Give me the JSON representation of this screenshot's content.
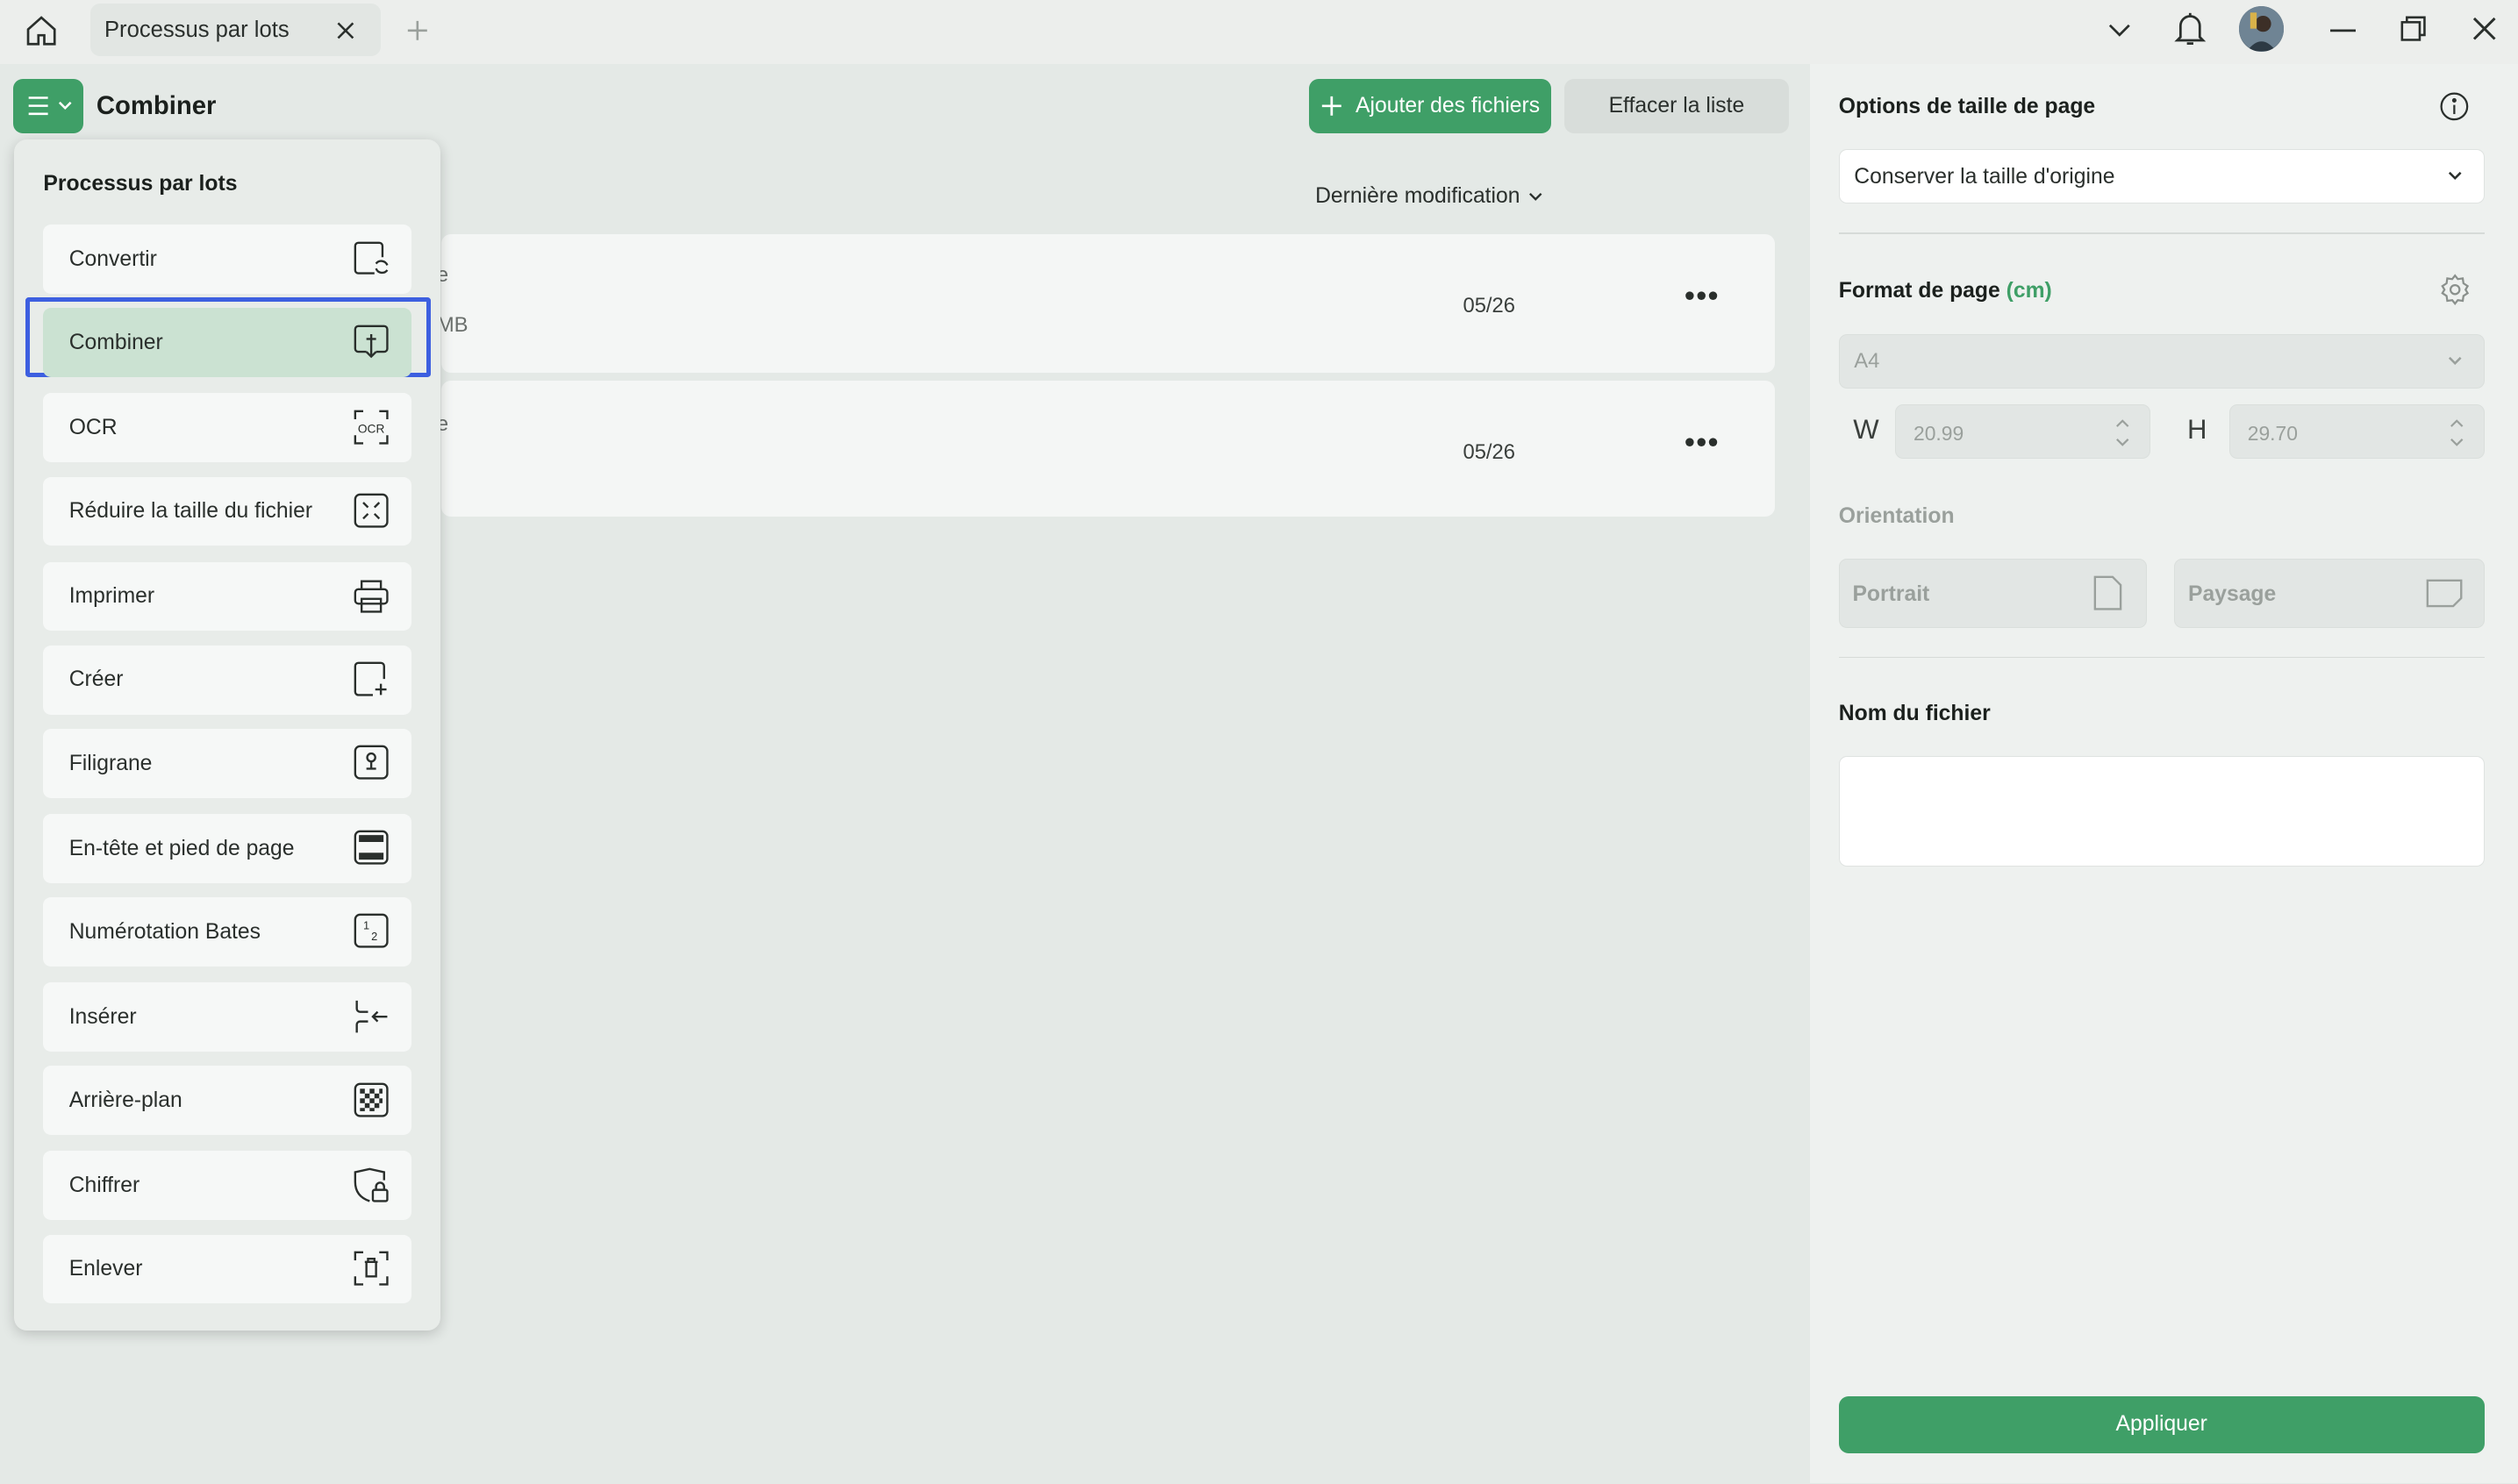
{
  "titlebar": {
    "tab_label": "Processus par lots",
    "icons": [
      "home-icon",
      "close-icon",
      "plus-icon",
      "chevron-down-icon",
      "bell-icon",
      "avatar",
      "minimize-icon",
      "restore-icon",
      "close-window-icon"
    ]
  },
  "header": {
    "title": "Combiner",
    "add_files": "Ajouter des fichiers",
    "clear_list": "Effacer la liste",
    "sort_label": "Dernière modification"
  },
  "files": [
    {
      "name_fragment": "e",
      "size_fragment": "MB",
      "date": "05/26"
    },
    {
      "name_fragment": "e",
      "date": "05/26"
    }
  ],
  "dropdown": {
    "title": "Processus par lots",
    "selected_index": 1,
    "items": [
      {
        "label": "Convertir",
        "icon": "convert-icon"
      },
      {
        "label": "Combiner",
        "icon": "combine-icon"
      },
      {
        "label": "OCR",
        "icon": "ocr-icon"
      },
      {
        "label": "Réduire la taille du fichier",
        "icon": "compress-icon"
      },
      {
        "label": "Imprimer",
        "icon": "printer-icon"
      },
      {
        "label": "Créer",
        "icon": "create-icon"
      },
      {
        "label": "Filigrane",
        "icon": "watermark-icon"
      },
      {
        "label": "En-tête et pied de page",
        "icon": "header-footer-icon"
      },
      {
        "label": "Numérotation Bates",
        "icon": "bates-icon"
      },
      {
        "label": "Insérer",
        "icon": "insert-icon"
      },
      {
        "label": "Arrière-plan",
        "icon": "background-icon"
      },
      {
        "label": "Chiffrer",
        "icon": "encrypt-icon"
      },
      {
        "label": "Enlever",
        "icon": "remove-icon"
      }
    ]
  },
  "panel": {
    "page_size_title": "Options de taille de page",
    "page_size_value": "Conserver la taille d'origine",
    "format_title": "Format de page",
    "format_unit": "(cm)",
    "format_value": "A4",
    "w_label": "W",
    "w_value": "20.99",
    "h_label": "H",
    "h_value": "29.70",
    "orientation_title": "Orientation",
    "portrait": "Portrait",
    "landscape": "Paysage",
    "filename_title": "Nom du fichier",
    "filename_value": "",
    "apply": "Appliquer"
  },
  "colors": {
    "accent": "#3f9f67",
    "selected_item": "#cbe2d2",
    "highlight_border": "#3d5fe0"
  }
}
